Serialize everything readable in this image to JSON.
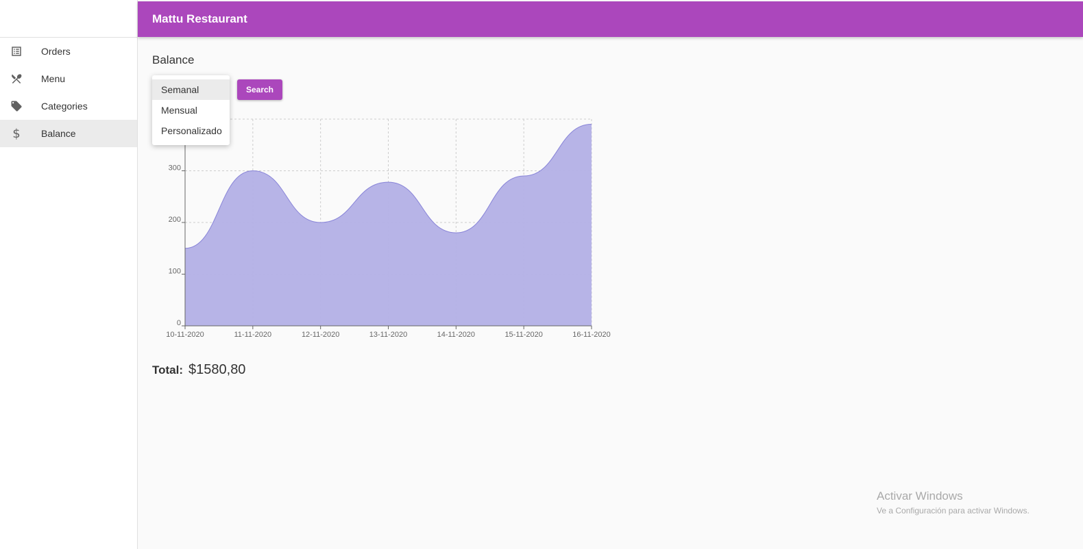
{
  "app": {
    "title": "Mattu Restaurant"
  },
  "sidebar": {
    "items": [
      {
        "label": "Orders",
        "icon": "list-icon"
      },
      {
        "label": "Menu",
        "icon": "utensils-icon"
      },
      {
        "label": "Categories",
        "icon": "tag-icon"
      },
      {
        "label": "Balance",
        "icon": "dollar-icon",
        "active": true
      }
    ]
  },
  "page": {
    "title": "Balance"
  },
  "filter": {
    "options": [
      "Semanal",
      "Mensual",
      "Personalizado"
    ],
    "selected": "Semanal",
    "search_label": "Search"
  },
  "chart_data": {
    "type": "area",
    "x": [
      "10-11-2020",
      "11-11-2020",
      "12-11-2020",
      "13-11-2020",
      "14-11-2020",
      "15-11-2020",
      "16-11-2020"
    ],
    "series": [
      {
        "values": [
          150,
          300,
          200,
          278,
          180,
          290,
          390
        ]
      }
    ],
    "yticks": [
      0,
      100,
      200,
      300
    ],
    "ylim": [
      0,
      400
    ],
    "grid": true,
    "fill_color": "#b3b0e6",
    "stroke_color": "#8884d8"
  },
  "total": {
    "label": "Total:",
    "value": "$1580,80"
  },
  "watermark": {
    "title": "Activar Windows",
    "subtitle": "Ve a Configuración para activar Windows."
  },
  "colors": {
    "primary": "#ab47bc",
    "sidebar_active": "#ebebeb"
  }
}
